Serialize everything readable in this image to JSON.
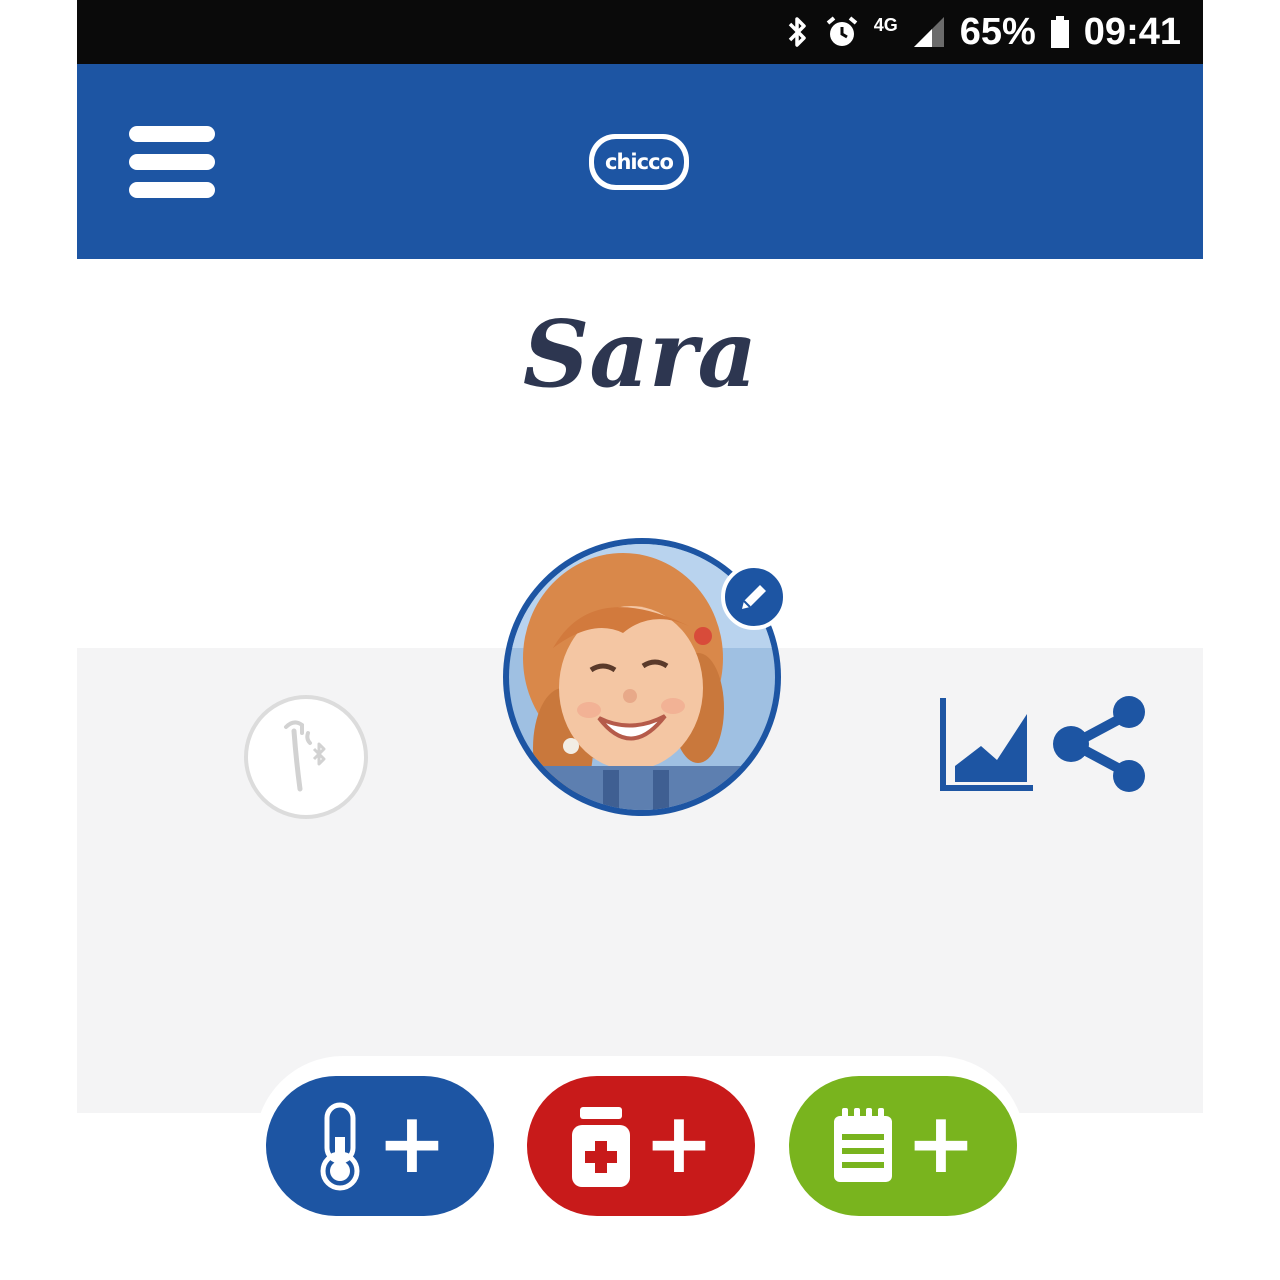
{
  "status_bar": {
    "network_label": "4G",
    "battery": "65%",
    "time": "09:41",
    "icons": [
      "bluetooth-icon",
      "alarm-icon",
      "signal-icon",
      "battery-icon"
    ]
  },
  "app_bar": {
    "logo_text": "chicco",
    "menu_icon": "hamburger-menu-icon",
    "color": "#1d55a3"
  },
  "profile": {
    "name": "Sara",
    "avatar": "child-photo",
    "edit_icon": "pencil-icon",
    "device_icon": "bluetooth-thermometer-icon",
    "chart_icon": "area-chart-icon",
    "share_icon": "share-icon"
  },
  "actions": [
    {
      "name": "add-temperature",
      "icon": "thermometer-icon",
      "symbol": "+",
      "color": "#1d55a3"
    },
    {
      "name": "add-medicine",
      "icon": "medicine-bottle-icon",
      "symbol": "+",
      "color": "#c81a1a"
    },
    {
      "name": "add-note",
      "icon": "notepad-icon",
      "symbol": "+",
      "color": "#79b41e"
    }
  ]
}
